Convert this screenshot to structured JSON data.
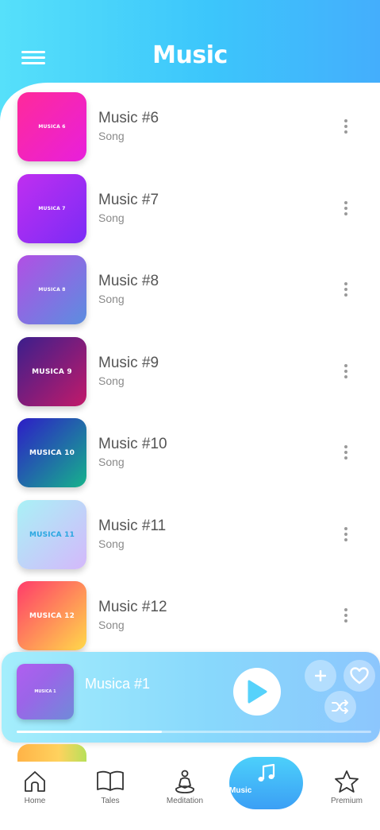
{
  "header": {
    "title": "Music"
  },
  "songs": [
    {
      "title": "Music #6",
      "subtitle": "Song",
      "art_label": "MUSICA 6",
      "art_colors": [
        "#ff2a9a",
        "#e81fdc"
      ]
    },
    {
      "title": "Music #7",
      "subtitle": "Song",
      "art_label": "MUSICA 7",
      "art_colors": [
        "#c02ef0",
        "#7a2cf6"
      ]
    },
    {
      "title": "Music #8",
      "subtitle": "Song",
      "art_label": "MUSICA 8",
      "art_colors": [
        "#b24fe4",
        "#5b8ee0"
      ]
    },
    {
      "title": "Music #9",
      "subtitle": "Song",
      "art_label": "MUSICA 9",
      "art_colors": [
        "#3b1f8c",
        "#c21a6a"
      ]
    },
    {
      "title": "Music #10",
      "subtitle": "Song",
      "art_label": "MUSICA 10",
      "art_colors": [
        "#2d1cc7",
        "#16b38c"
      ]
    },
    {
      "title": "Music #11",
      "subtitle": "Song",
      "art_label": "MUSICA 11",
      "art_colors": [
        "#a9f1f6",
        "#d4b8fb"
      ]
    },
    {
      "title": "Music #12",
      "subtitle": "Song",
      "art_label": "MUSICA 12",
      "art_colors": [
        "#ff3b6a",
        "#ffd94a"
      ]
    }
  ],
  "player": {
    "title": "Musica #1",
    "art_label": "MUSICA 1",
    "progress": 0.41
  },
  "nav": {
    "items": [
      {
        "label": "Home",
        "icon": "home-icon"
      },
      {
        "label": "Tales",
        "icon": "book-icon"
      },
      {
        "label": "Meditation",
        "icon": "meditation-icon"
      },
      {
        "label": "Music",
        "icon": "music-note-icon",
        "active": true
      },
      {
        "label": "Premium",
        "icon": "star-icon"
      }
    ]
  },
  "colors": {
    "header_gradient": [
      "#56e0fa",
      "#44aefc"
    ],
    "active_nav": "#3b9ff5",
    "play_icon": "#56d2fb"
  }
}
